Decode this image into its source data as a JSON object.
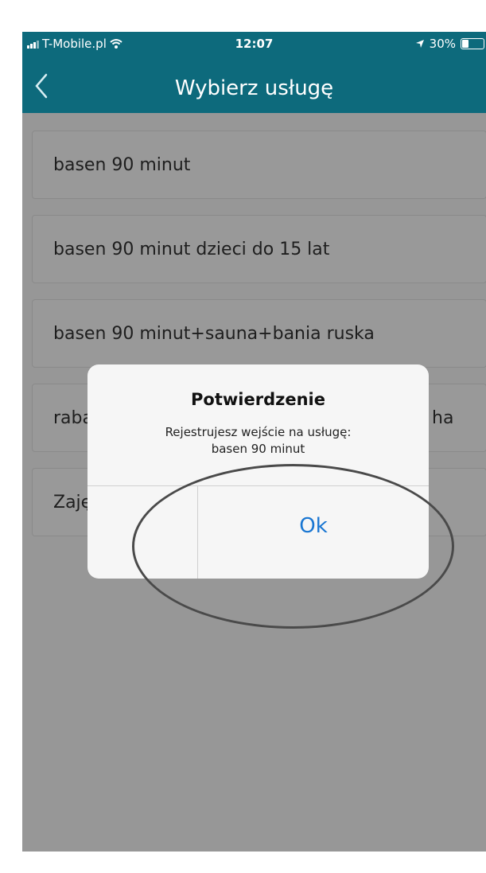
{
  "status_bar": {
    "carrier": "T-Mobile.pl",
    "time": "12:07",
    "battery": "30%",
    "icons": [
      "signal-icon",
      "wifi-icon",
      "location-arrow-icon",
      "battery-icon"
    ]
  },
  "nav": {
    "title": "Wybierz usługę",
    "back_icon": "chevron-left-icon"
  },
  "services": [
    {
      "label": "basen 90 minut"
    },
    {
      "label": "basen 90 minut dzieci do 15 lat"
    },
    {
      "label": "basen 90 minut+sauna+bania ruska"
    },
    {
      "label": "raba",
      "label_suffix": "ha"
    },
    {
      "label": "Zaję"
    }
  ],
  "dialog": {
    "title": "Potwierdzenie",
    "message_line1": "Rejestrujesz wejście na usługę:",
    "message_line2": "basen 90 minut",
    "ok_label": "Ok"
  },
  "colors": {
    "header": "#0d6a7c",
    "background_dimmed": "#979797",
    "dialog_background": "#f6f6f6",
    "button_text": "#1976d2"
  }
}
